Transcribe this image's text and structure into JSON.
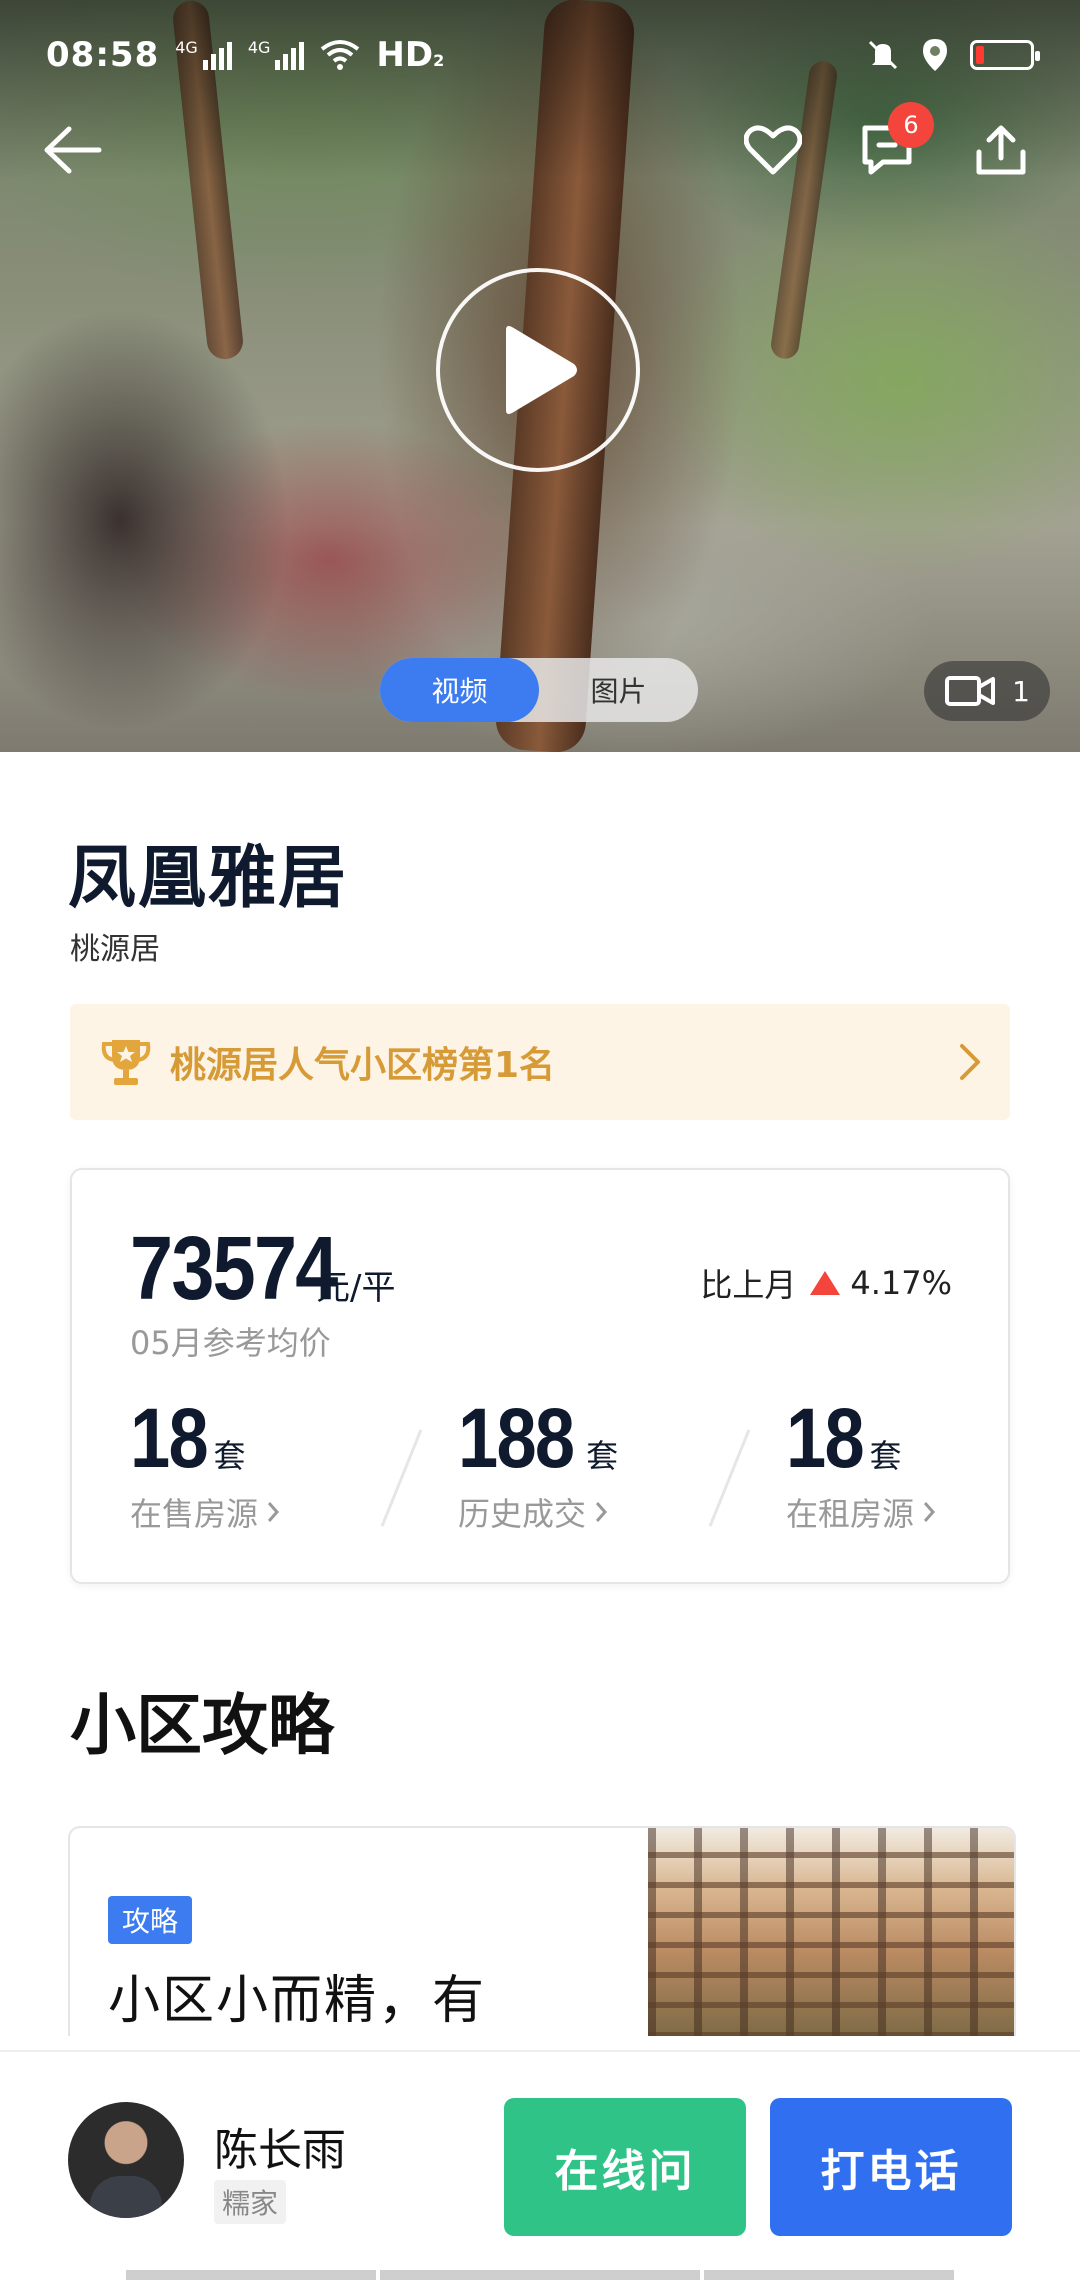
{
  "status_bar": {
    "time": "08:58",
    "network1": "4G",
    "network2": "4G",
    "hd": "HD",
    "hd_sub": "2"
  },
  "header": {
    "message_badge": "6"
  },
  "media": {
    "tabs": [
      "视频",
      "图片"
    ],
    "active_tab": "视频",
    "video_count": "1"
  },
  "community": {
    "name": "凤凰雅居",
    "area": "桃源居"
  },
  "ranking": {
    "text": "桃源居人气小区榜第1名"
  },
  "price": {
    "value": "73574",
    "unit": "元/平",
    "label": "05月参考均价",
    "mom_label": "比上月",
    "mom_value": "4.17%"
  },
  "stats": [
    {
      "value": "18",
      "unit": "套",
      "label": "在售房源"
    },
    {
      "value": "188",
      "unit": "套",
      "label": "历史成交"
    },
    {
      "value": "18",
      "unit": "套",
      "label": "在租房源"
    }
  ],
  "guide": {
    "section_title": "小区攻略",
    "tag": "攻略",
    "title": "小区小而精，有"
  },
  "agent": {
    "name": "陈长雨",
    "company": "糯家"
  },
  "actions": {
    "chat_label": "在线问",
    "call_label": "打电话"
  },
  "colors": {
    "accent_blue": "#3d7cf0",
    "green": "#2fc388",
    "gold": "#d69a36",
    "badge_red": "#f4453c"
  }
}
